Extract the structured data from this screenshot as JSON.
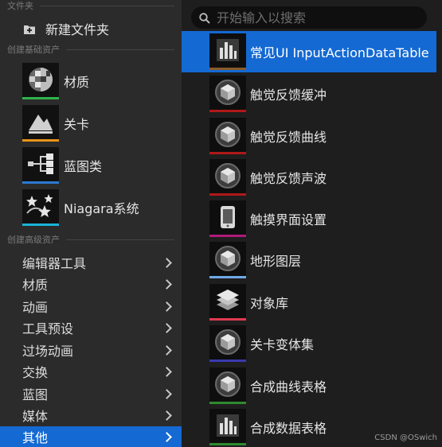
{
  "left": {
    "section_top": "文件夹",
    "new_folder": "新建文件夹",
    "section_basic": "创建基础资产",
    "basic_items": [
      {
        "label": "材质",
        "bar_color": "#2fb34a",
        "icon": "material-ball-icon"
      },
      {
        "label": "关卡",
        "bar_color": "#e8941a",
        "icon": "level-mountain-icon"
      },
      {
        "label": "蓝图类",
        "bar_color": "#2e7ad1",
        "icon": "blueprint-graph-icon"
      },
      {
        "label": "Niagara系统",
        "bar_color": "#19b4d8",
        "icon": "niagara-stars-icon"
      }
    ],
    "section_advanced": "创建高级资产",
    "advanced_items": [
      {
        "label": "编辑器工具"
      },
      {
        "label": "材质"
      },
      {
        "label": "动画"
      },
      {
        "label": "工具预设"
      },
      {
        "label": "过场动画"
      },
      {
        "label": "交换"
      },
      {
        "label": "蓝图"
      },
      {
        "label": "媒体"
      },
      {
        "label": "其他"
      }
    ]
  },
  "right": {
    "search_placeholder": "开始输入以搜索",
    "assets": [
      {
        "label": "常见UI InputActionDataTable",
        "bar_color": "#8a5a2a",
        "icon": "data-table-icon"
      },
      {
        "label": "触觉反馈缓冲",
        "bar_color": "#b01818",
        "icon": "cube-icon"
      },
      {
        "label": "触觉反馈曲线",
        "bar_color": "#b01818",
        "icon": "cube-icon"
      },
      {
        "label": "触觉反馈声波",
        "bar_color": "#b01818",
        "icon": "cube-icon"
      },
      {
        "label": "触摸界面设置",
        "bar_color": "#b0197a",
        "icon": "tablet-icon"
      },
      {
        "label": "地形图层",
        "bar_color": "#6fa8e8",
        "icon": "cube-icon"
      },
      {
        "label": "对象库",
        "bar_color": "#e03a52",
        "icon": "stack-icon"
      },
      {
        "label": "关卡变体集",
        "bar_color": "#3a3ab0",
        "icon": "cube-icon"
      },
      {
        "label": "合成曲线表格",
        "bar_color": "#2f8a2f",
        "icon": "cube-icon"
      },
      {
        "label": "合成数据表格",
        "bar_color": "#2f8a2f",
        "icon": "data-table-icon"
      }
    ]
  },
  "watermark": "CSDN @OSwich",
  "accent": "#1469d2"
}
